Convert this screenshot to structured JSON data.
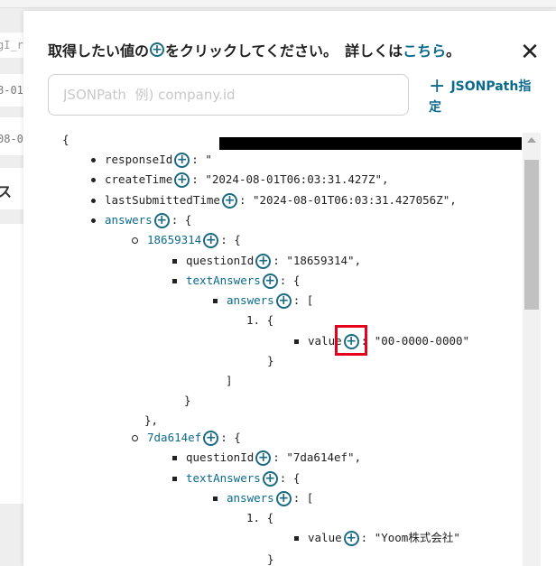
{
  "background": {
    "fragments": [
      "gI_r",
      "8-01",
      "08-0",
      "ス"
    ]
  },
  "dialog": {
    "instruction_pre": "取得したい値の",
    "instruction_post": "をクリックしてください。",
    "help_prefix": "詳しくは",
    "help_link": "こちら",
    "help_suffix": "。",
    "close_label": "✕"
  },
  "search": {
    "placeholder": "JSONPath  例) company.id",
    "value": ""
  },
  "add_path": {
    "label": "JSONPath指定"
  },
  "icons": {
    "plus": "plus-circle-icon",
    "close": "close-icon",
    "add": "plus-icon"
  },
  "colors": {
    "accent": "#0b6a8c",
    "highlight": "#e6001b"
  },
  "tree": {
    "open_brace": "{",
    "response_id": {
      "key": "responseId",
      "value": "\""
    },
    "create_time": {
      "key": "createTime",
      "value": "\"2024-08-01T06:03:31.427Z\","
    },
    "last_submitted": {
      "key": "lastSubmittedTime",
      "value": "\"2024-08-01T06:03:31.427056Z\","
    },
    "answers": {
      "key": "answers",
      "tail": ": {"
    },
    "q1": {
      "key": "18659314",
      "tail": ": {",
      "question_id": {
        "key": "questionId",
        "value": ": \"18659314\","
      },
      "text_answers": {
        "key": "textAnswers",
        "tail": ": {"
      },
      "answers": {
        "key": "answers",
        "tail": ": ["
      },
      "item_index": "1. {",
      "value": {
        "key": "value",
        "value": ": \"00-0000-0000\""
      },
      "close_inner": "}",
      "close_array": "]",
      "close_obj": "}",
      "close_q": "},"
    },
    "q2": {
      "key": "7da614ef",
      "tail": ": {",
      "question_id": {
        "key": "questionId",
        "value": ": \"7da614ef\","
      },
      "text_answers": {
        "key": "textAnswers",
        "tail": ": {"
      },
      "answers": {
        "key": "answers",
        "tail": ": ["
      },
      "item_index": "1. {",
      "value": {
        "key": "value",
        "value": ": \"Yoom株式会社\""
      },
      "close_inner": "}"
    }
  }
}
